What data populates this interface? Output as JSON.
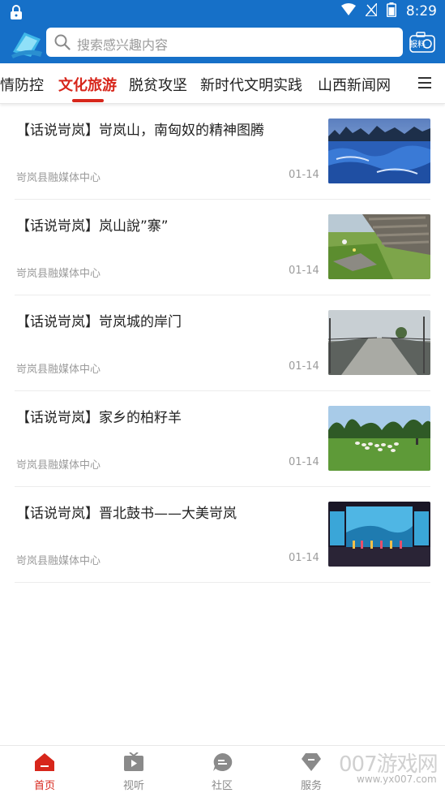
{
  "status_bar": {
    "time": "8:29"
  },
  "search": {
    "placeholder": "搜索感兴趣内容"
  },
  "header": {
    "report_label": "报料"
  },
  "tabs": [
    {
      "label": "疫情防控",
      "active": false
    },
    {
      "label": "文化旅游",
      "active": true
    },
    {
      "label": "脱贫攻坚",
      "active": false
    },
    {
      "label": "新时代文明实践",
      "active": false
    },
    {
      "label": "山西新闻网",
      "active": false
    }
  ],
  "news": [
    {
      "title": "【话说岢岚】岢岚山，南匈奴的精神图腾",
      "source": "岢岚县融媒体中心",
      "date": "01-14",
      "thumb": "snowy-forest"
    },
    {
      "title": "【话说岢岚】岚山說”寨”",
      "source": "岢岚县融媒体中心",
      "date": "01-14",
      "thumb": "stone-wall-grass"
    },
    {
      "title": "【话说岢岚】岢岚城的岸门",
      "source": "岢岚县融媒体中心",
      "date": "01-14",
      "thumb": "bridge-walkway"
    },
    {
      "title": "【话说岢岚】家乡的柏籽羊",
      "source": "岢岚县融媒体中心",
      "date": "01-14",
      "thumb": "sheep-meadow"
    },
    {
      "title": "【话说岢岚】晋北鼓书——大美岢岚",
      "source": "岢岚县融媒体中心",
      "date": "01-14",
      "thumb": "stage-performance"
    }
  ],
  "bottom_nav": [
    {
      "label": "首页",
      "icon": "home-icon",
      "active": true
    },
    {
      "label": "视听",
      "icon": "tv-play-icon",
      "active": false
    },
    {
      "label": "社区",
      "icon": "chat-bubble-icon",
      "active": false
    },
    {
      "label": "服务",
      "icon": "diamond-icon",
      "active": false
    }
  ],
  "watermark": {
    "text": "007游戏网",
    "url": "www.yx007.com"
  },
  "colors": {
    "brand_blue": "#1670c8",
    "accent_red": "#d7261b"
  }
}
